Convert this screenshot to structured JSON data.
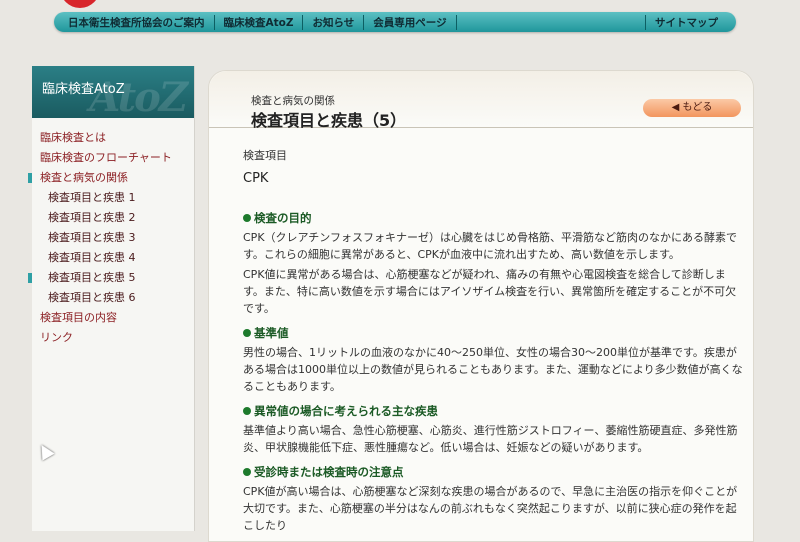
{
  "nav": {
    "items": [
      "日本衛生検査所協会のご案内",
      "臨床検査AtoZ",
      "お知らせ",
      "会員専用ページ"
    ],
    "sitemap": "サイトマップ"
  },
  "sidebar": {
    "title": "臨床検査AtoZ",
    "watermark": "AtoZ",
    "items": [
      {
        "label": "臨床検査とは"
      },
      {
        "label": "臨床検査のフローチャート"
      },
      {
        "label": "検査と病気の関係"
      },
      {
        "label": "検査項目と疾患 1"
      },
      {
        "label": "検査項目と疾患 2"
      },
      {
        "label": "検査項目と疾患 3"
      },
      {
        "label": "検査項目と疾患 4"
      },
      {
        "label": "検査項目と疾患 5"
      },
      {
        "label": "検査項目と疾患 6"
      },
      {
        "label": "検査項目の内容"
      },
      {
        "label": "リンク"
      }
    ]
  },
  "content": {
    "breadcrumb": "検査と病気の関係",
    "title": "検査項目と疾患（5）",
    "back_label": "◀ もどる",
    "item_label": "検査項目",
    "item_name": "CPK",
    "sections": [
      {
        "heading": "検査の目的",
        "paragraphs": [
          "CPK（クレアチンフォスフォキナーゼ）は心臓をはじめ骨格筋、平滑筋など筋肉のなかにある酵素です。これらの細胞に異常があると、CPKが血液中に流れ出すため、高い数値を示します。",
          "CPK値に異常がある場合は、心筋梗塞などが疑われ、痛みの有無や心電図検査を総合して診断します。また、特に高い数値を示す場合にはアイソザイム検査を行い、異常箇所を確定することが不可欠です。"
        ]
      },
      {
        "heading": "基準値",
        "paragraphs": [
          "男性の場合、1リットルの血液のなかに40～250単位、女性の場合30～200単位が基準です。疾患がある場合は1000単位以上の数値が見られることもあります。また、運動などにより多少数値が高くなることもあります。"
        ]
      },
      {
        "heading": "異常値の場合に考えられる主な疾患",
        "paragraphs": [
          "基準値より高い場合、急性心筋梗塞、心筋炎、進行性筋ジストロフィー、萎縮性筋硬直症、多発性筋炎、甲状腺機能低下症、悪性腫瘍など。低い場合は、妊娠などの疑いがあります。"
        ]
      },
      {
        "heading": "受診時または検査時の注意点",
        "paragraphs": [
          "CPK値が高い場合は、心筋梗塞など深刻な疾患の場合があるので、早急に主治医の指示を仰ぐことが大切です。また、心筋梗塞の半分はなんの前ぶれもなく突然起こりますが、以前に狭心症の発作を起こしたり"
        ]
      }
    ]
  }
}
